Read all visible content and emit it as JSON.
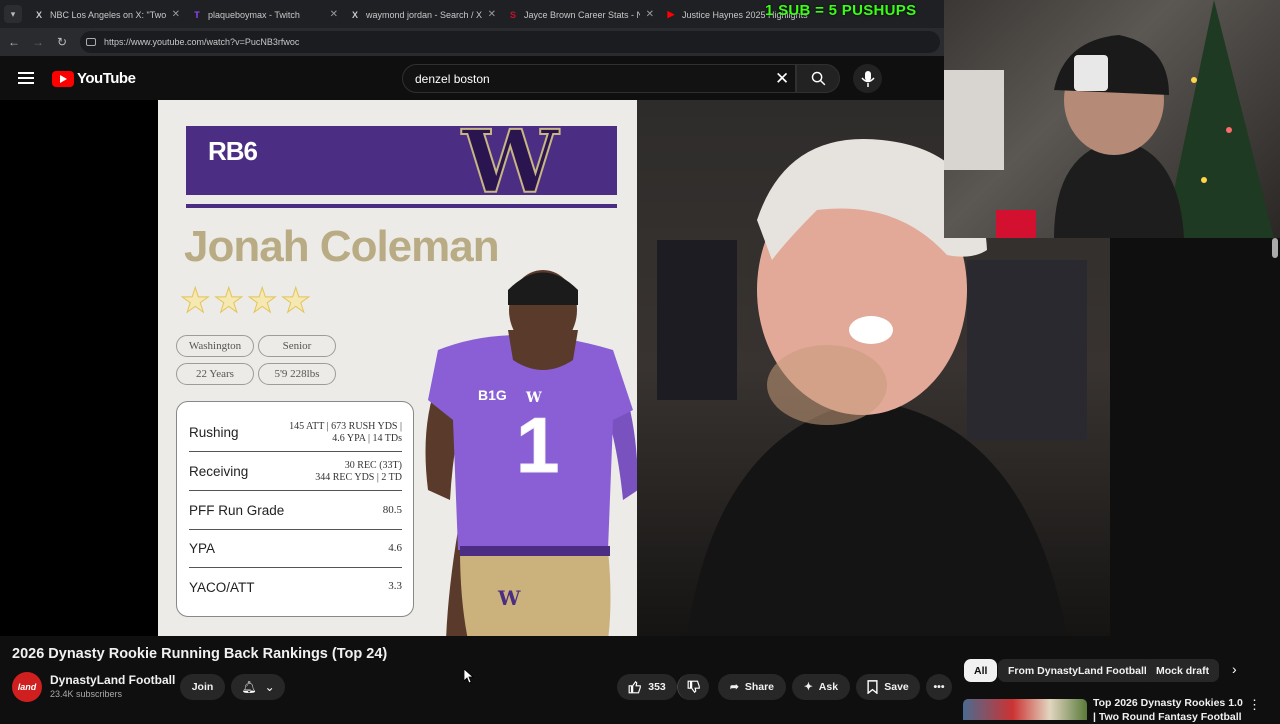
{
  "browser": {
    "tabs": [
      {
        "icon": "X",
        "title": "NBC Los Angeles on X: \"Two m"
      },
      {
        "icon": "T",
        "title": "plaqueboymax - Twitch"
      },
      {
        "icon": "X",
        "title": "waymond jordan - Search / X"
      },
      {
        "icon": "S",
        "title": "Jayce Brown Career Stats - NCA"
      },
      {
        "icon": "▶",
        "title": "Justice Haynes 2025 Highlights"
      }
    ],
    "url": "https://www.youtube.com/watch?v=PucNB3rfwoc"
  },
  "stream_overlay": {
    "text": "1 SUB = 5 PUSHUPS"
  },
  "youtube": {
    "logo_text": "YouTube",
    "search_value": "denzel boston"
  },
  "card": {
    "position_rank": "RB6",
    "player_name": "Jonah Coleman",
    "stars": 4,
    "school": "Washington",
    "class": "Senior",
    "age": "22 Years",
    "size": "5'9 228lbs",
    "stats": [
      {
        "label": "Rushing",
        "value_line1": "145 ATT | 673 RUSH YDS |",
        "value_line2": "4.6 YPA | 14 TDs"
      },
      {
        "label": "Receiving",
        "value_line1": "30 REC (33T)",
        "value_line2": "344 REC YDS | 2 TD"
      },
      {
        "label": "PFF Run Grade",
        "value_line1": "80.5",
        "value_line2": ""
      },
      {
        "label": "YPA",
        "value_line1": "4.6",
        "value_line2": ""
      },
      {
        "label": "YACO/ATT",
        "value_line1": "3.3",
        "value_line2": ""
      }
    ],
    "jersey_number": "1"
  },
  "video": {
    "title": "2026 Dynasty Rookie Running Back Rankings (Top 24)",
    "channel_avatar_text": "land",
    "channel_name": "DynastyLand Football",
    "subscribers": "23.4K subscribers",
    "join_label": "Join",
    "likes": "353",
    "share_label": "Share",
    "ask_label": "Ask",
    "save_label": "Save"
  },
  "sidebar": {
    "chips": [
      "All",
      "From DynastyLand Football",
      "Mock draft"
    ],
    "recommended_title": "Top 2026 Dynasty Rookies 1.0 | Two Round Fantasy Football"
  },
  "colors": {
    "uw_purple": "#4b2e83",
    "uw_gold": "#b9ac84",
    "overlay_green": "#39ff14",
    "yt_red": "#ff0000"
  }
}
